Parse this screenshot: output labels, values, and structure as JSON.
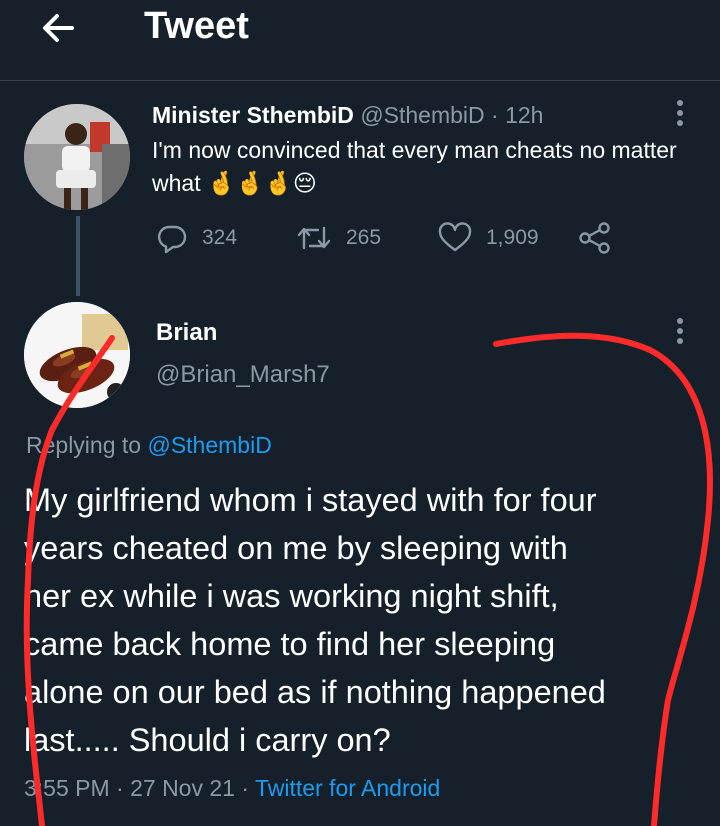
{
  "header": {
    "title": "Tweet"
  },
  "tweet1": {
    "display_name": "Minister SthembiD",
    "handle": "@SthembiD",
    "age": " · 12h",
    "text": "I'm now convinced that every man cheats no matter what 🤞🤞🤞😔",
    "replies": "324",
    "retweets": "265",
    "likes": "1,909"
  },
  "tweet2": {
    "display_name": "Brian",
    "handle": "@Brian_Marsh7",
    "replying_prefix": "Replying to ",
    "replying_to": "@SthembiD",
    "lines": [
      "My girlfriend whom i stayed with for four",
      "years cheated on me by sleeping with",
      "her ex while i was working night shift,",
      "came back home to find her sleeping",
      "alone on our bed as if nothing happened",
      "last..... Should i carry on?"
    ],
    "timestamp": "3:55 PM · 27 Nov 21 · ",
    "client": "Twitter for Android"
  },
  "colors": {
    "background": "#15202b",
    "secondary_text": "#8b98a5",
    "link": "#1d9bf0",
    "annotation": "#ff2a2a"
  },
  "icons": [
    "back-arrow-icon",
    "more-vertical-icon",
    "reply-icon",
    "retweet-icon",
    "like-icon",
    "share-icon"
  ]
}
